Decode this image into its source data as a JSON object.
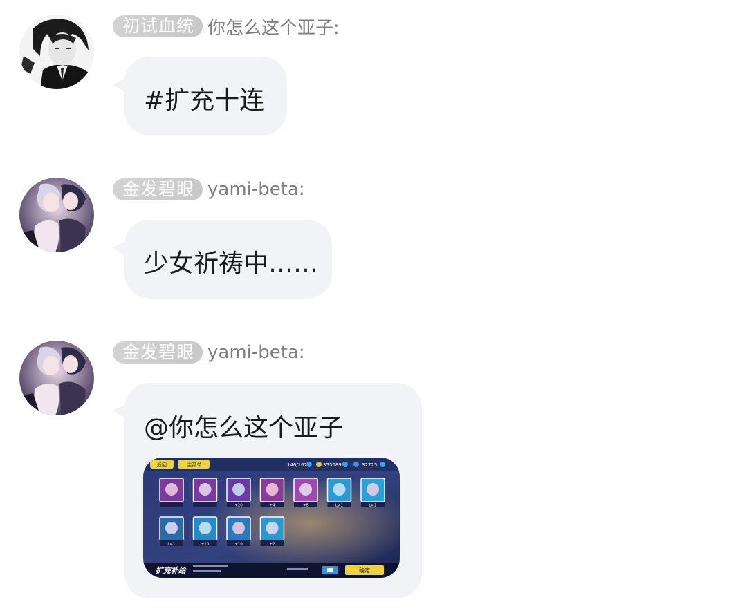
{
  "messages": [
    {
      "title_badge": "初试血统",
      "sender": "你怎么这个亚子:",
      "text": "#扩充十连",
      "avatar_icon": "avatar-boy-grayscale"
    },
    {
      "title_badge": "金发碧眼",
      "sender": "yami-beta:",
      "text": "少女祈祷中……",
      "avatar_icon": "avatar-anime-girls"
    },
    {
      "title_badge": "金发碧眼",
      "sender": "yami-beta:",
      "text": "@你怎么这个亚子",
      "avatar_icon": "avatar-anime-girls",
      "attachment": {
        "type": "game-screenshot",
        "back_label": "返回",
        "home_label": "主菜单",
        "stamina": "146/162",
        "coins": "3550896",
        "crystals": "32725",
        "banner_title": "扩充补给",
        "confirm_label": "确定",
        "card_levels": [
          "",
          "",
          "+20",
          "+4",
          "+8",
          "Lv.1",
          "Lv.1",
          "Lv.1",
          "+10",
          "+10",
          "+2"
        ]
      }
    }
  ],
  "colors": {
    "bubble": "#f2f3f7",
    "badge": "#cccccc",
    "sender": "#7f7f7f",
    "text": "#1a1a1a"
  }
}
